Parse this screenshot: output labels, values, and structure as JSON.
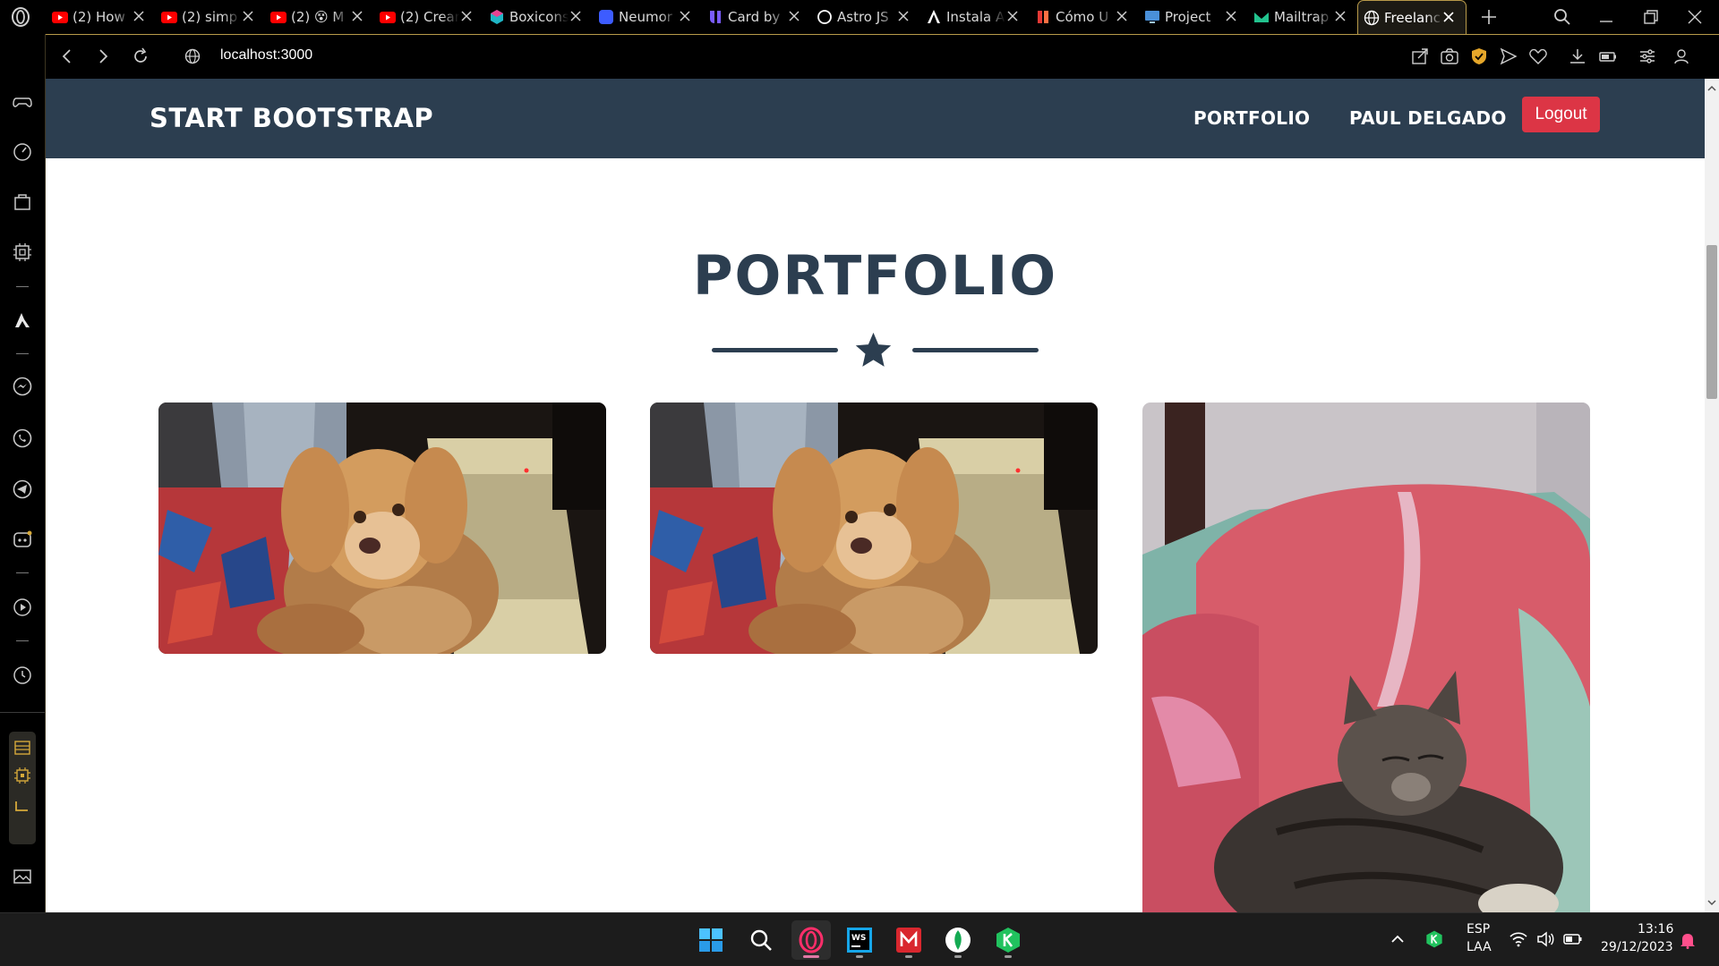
{
  "browser": {
    "tabs": [
      {
        "title": "(2) How",
        "icon": "youtube-icon",
        "color": "#ff0000"
      },
      {
        "title": "(2) simp",
        "icon": "youtube-icon",
        "color": "#ff0000"
      },
      {
        "title": "(2) 😵 M",
        "icon": "youtube-icon",
        "color": "#ff0000"
      },
      {
        "title": "(2) Crear",
        "icon": "youtube-icon",
        "color": "#ff0000"
      },
      {
        "title": "Boxicons",
        "icon": "boxicons-icon",
        "color": "#1fb6c6"
      },
      {
        "title": "Neumor",
        "icon": "neumorphism-icon",
        "color": "#3d5cff"
      },
      {
        "title": "Card by",
        "icon": "uiverse-icon",
        "color": "#7a5cff"
      },
      {
        "title": "Astro JS",
        "icon": "astro-icon",
        "color": "#ffffff"
      },
      {
        "title": "Instala A",
        "icon": "angular-icon",
        "color": "#ffffff"
      },
      {
        "title": "Cómo U",
        "icon": "bookmark-icon",
        "color": "#e53935"
      },
      {
        "title": "Project",
        "icon": "monitor-icon",
        "color": "#4a90d9"
      },
      {
        "title": "Mailtrap",
        "icon": "mailtrap-icon",
        "color": "#22c38e"
      },
      {
        "title": "Freelanc",
        "icon": "globe-icon",
        "color": "#ffffff",
        "active": true
      }
    ],
    "url": "localhost:3000"
  },
  "site": {
    "brand": "START BOOTSTRAP",
    "nav": {
      "portfolio": "PORTFOLIO",
      "user": "PAUL DELGADO",
      "logout": "Logout"
    },
    "section_title": "PORTFOLIO",
    "portfolio_items": [
      {
        "subject": "puppy-photo"
      },
      {
        "subject": "puppy-photo"
      },
      {
        "subject": "cat-photo"
      }
    ]
  },
  "taskbar": {
    "apps": [
      "windows-start-icon",
      "search-icon",
      "opera-icon",
      "webstorm-icon",
      "mega-icon",
      "mongodb-icon",
      "kotlin-icon"
    ],
    "language": "ESP",
    "layout": "LAA",
    "time": "13:16",
    "date": "29/12/2023"
  },
  "colors": {
    "navbar": "#2c3e50",
    "logout": "#dc3545",
    "heading": "#2c3e50"
  }
}
